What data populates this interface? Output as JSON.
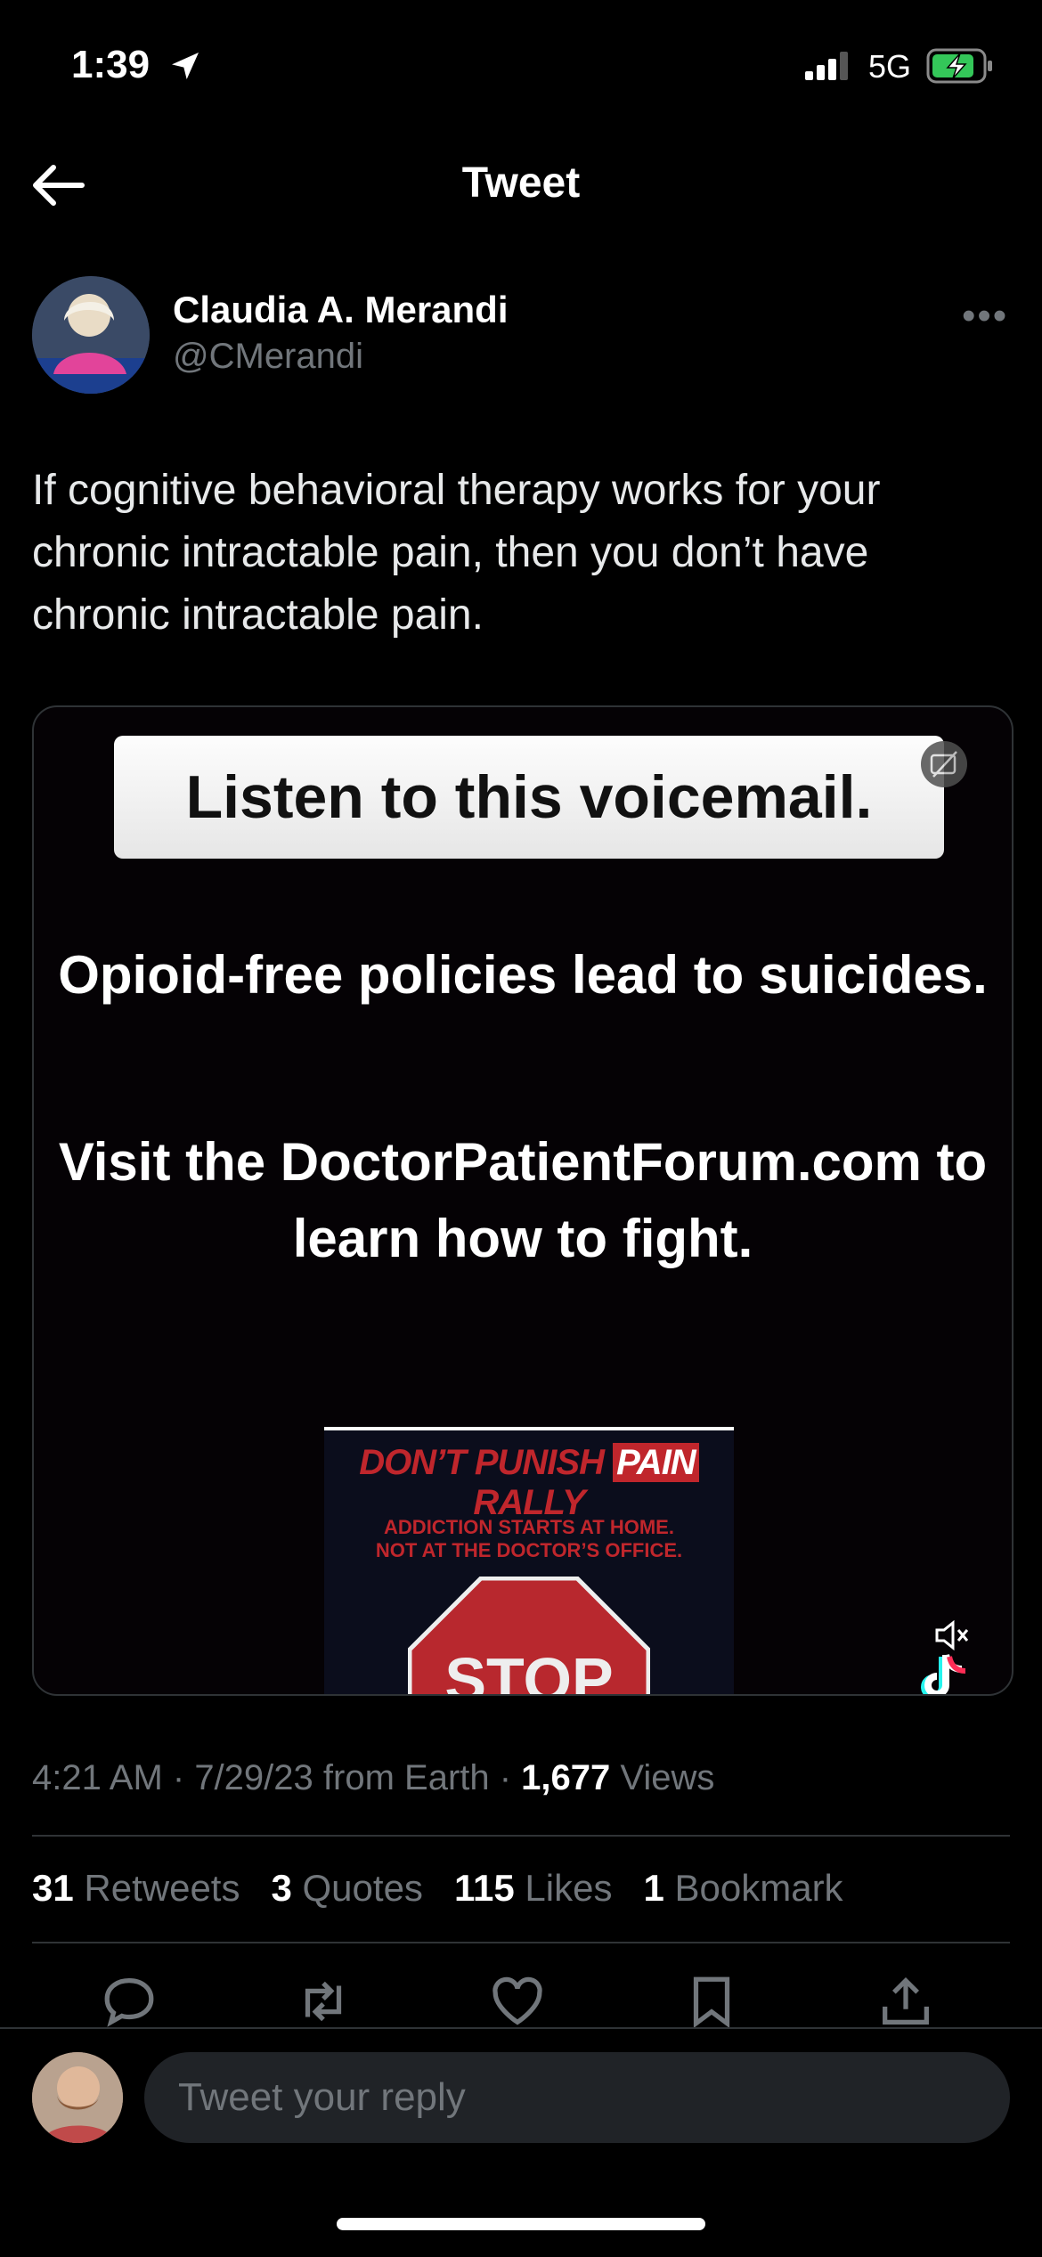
{
  "status_bar": {
    "time": "1:39",
    "network": "5G"
  },
  "nav": {
    "title": "Tweet"
  },
  "author": {
    "name": "Claudia A. Merandi",
    "handle": "@CMerandi"
  },
  "more_label": "•••",
  "tweet": {
    "text": "If cognitive behavioral therapy works for your chronic intractable pain, then you don’t have chronic intractable pain."
  },
  "media": {
    "banner": "Listen to this voicemail.",
    "line1": "Opioid-free policies lead to suicides.",
    "line2": "Visit the DoctorPatientForum.com to learn how to fight.",
    "rally_title_a": "DON’T PUNISH",
    "rally_title_pain": "PAIN",
    "rally_title_b": "RALLY",
    "rally_sub_1": "ADDICTION STARTS AT HOME.",
    "rally_sub_2": "NOT AT THE DOCTOR’S OFFICE.",
    "stop": "STOP"
  },
  "meta": {
    "time": "4:21 AM",
    "date": "7/29/23",
    "source": "from Earth",
    "views_count": "1,677",
    "views_label": "Views"
  },
  "stats": {
    "retweets": "31",
    "retweets_label": "Retweets",
    "quotes": "3",
    "quotes_label": "Quotes",
    "likes": "115",
    "likes_label": "Likes",
    "bookmarks": "1",
    "bookmarks_label": "Bookmark"
  },
  "reply": {
    "placeholder": "Tweet your reply"
  },
  "colors": {
    "background": "#000000",
    "muted": "#71767b",
    "divider": "#2f3336",
    "rally_red": "#c0262c"
  },
  "icons": [
    "location-arrow-icon",
    "signal-icon",
    "battery-charging-icon",
    "back-arrow-icon",
    "more-icon",
    "cc-icon",
    "mute-icon",
    "tiktok-icon",
    "reply-icon",
    "retweet-icon",
    "like-icon",
    "bookmark-icon",
    "share-icon"
  ]
}
